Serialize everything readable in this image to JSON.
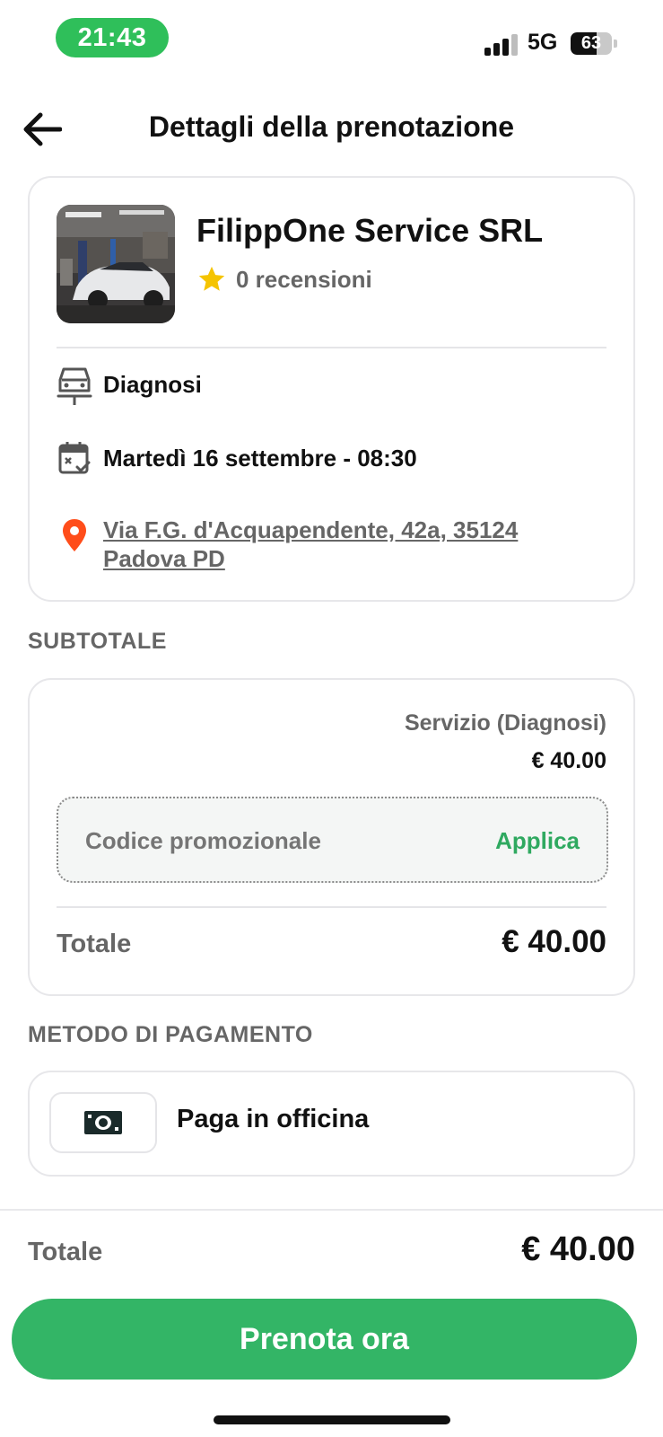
{
  "status_bar": {
    "time": "21:43",
    "network": "5G",
    "battery": "63",
    "battery_level": 0.63
  },
  "header": {
    "title": "Dettagli della prenotazione",
    "back_icon": "arrow-left-icon"
  },
  "shop": {
    "name": "FilippOne Service SRL",
    "rating_text": "0 recensioni",
    "star_color": "#f5c400",
    "service": "Diagnosi",
    "datetime": "Martedì 16 settembre - 08:30",
    "address": "Via F.G. d'Acquapendente, 42a, 35124 Padova PD",
    "pin_color": "#ff4d1a"
  },
  "subtotal": {
    "section_label": "SUBTOTALE",
    "service_label": "Servizio (Diagnosi)",
    "service_price": "€ 40.00",
    "promo_placeholder": "Codice promozionale",
    "promo_apply": "Applica",
    "total_label": "Totale",
    "total_value": "€ 40.00"
  },
  "payment": {
    "section_label": "METODO DI PAGAMENTO",
    "method_label": "Paga in officina",
    "method_icon": "cash-icon"
  },
  "footer": {
    "total_label": "Totale",
    "total_value": "€ 40.00",
    "cta_label": "Prenota ora",
    "accent": "#33b566"
  }
}
